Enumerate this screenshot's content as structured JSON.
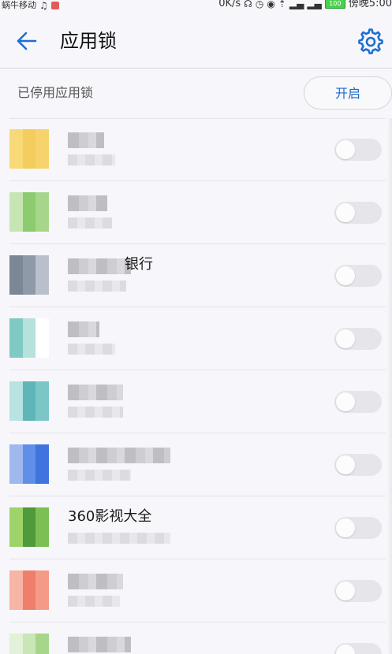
{
  "status_bar": {
    "carrier": "蜗牛移动",
    "right_text": "0K/s",
    "battery": "100",
    "time": "傍晚5:00"
  },
  "header": {
    "title": "应用锁"
  },
  "lock_status": {
    "label": "已停用应用锁",
    "button_label": "开启"
  },
  "apps": [
    {
      "name": "",
      "icon_colors": [
        "#f8d978",
        "#f3cd5d",
        "#f6d36c"
      ],
      "toggle_on": false
    },
    {
      "name": "",
      "icon_colors": [
        "#a6d68a",
        "#c6e5b3",
        "#8ccb6e"
      ],
      "toggle_on": false
    },
    {
      "name": "银行",
      "icon_colors": [
        "#8f9aa8",
        "#b9c0cb",
        "#7c8796"
      ],
      "toggle_on": false
    },
    {
      "name": "",
      "icon_colors": [
        "#7fcac3",
        "#b6e1dd",
        "#ffffff"
      ],
      "toggle_on": false
    },
    {
      "name": "",
      "icon_colors": [
        "#7cc6c8",
        "#b9e2e2",
        "#5eb6b9"
      ],
      "toggle_on": false
    },
    {
      "name": "",
      "icon_colors": [
        "#5f8fe8",
        "#3f73dd",
        "#9fb8ee"
      ],
      "toggle_on": false
    },
    {
      "name": "360影视大全",
      "icon_colors": [
        "#9ed36a",
        "#4f9a3c",
        "#7cbf55"
      ],
      "toggle_on": false
    },
    {
      "name": "",
      "icon_colors": [
        "#f59a86",
        "#f7b5a6",
        "#ef7f6a"
      ],
      "toggle_on": false
    },
    {
      "name": "",
      "icon_colors": [
        "#c9e6b6",
        "#a6d68c",
        "#e3f1d8"
      ],
      "toggle_on": false
    }
  ]
}
